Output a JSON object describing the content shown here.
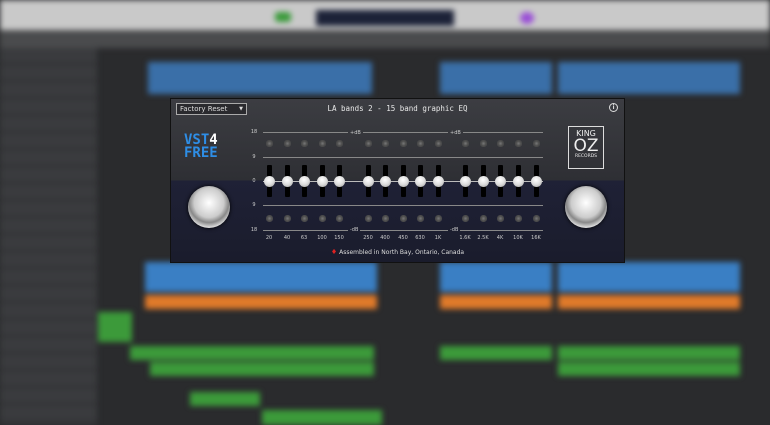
{
  "plugin": {
    "preset": "Factory Reset",
    "title": "LA bands 2 - 15 band graphic EQ",
    "info_icon": "info-icon",
    "logo_left": {
      "line1": "VST",
      "digit": "4",
      "line2": "FREE"
    },
    "logo_right": {
      "top": "KING",
      "middle": "OZ",
      "bottom": "RECORDS"
    },
    "scale": [
      "18",
      "9",
      "0",
      "9",
      "18"
    ],
    "db_label": "-dB",
    "db_label_top": "+dB",
    "bands": [
      "20",
      "40",
      "63",
      "100",
      "150",
      "250",
      "400",
      "450",
      "630",
      "1K",
      "1.6K",
      "2.5K",
      "4K",
      "10K",
      "16K"
    ],
    "band_gains_db": [
      0,
      0,
      0,
      0,
      0,
      0,
      0,
      0,
      0,
      0,
      0,
      0,
      0,
      0,
      0
    ],
    "footer": "Assembled in North Bay, Ontario, Canada"
  },
  "colors": {
    "accent_blue": "#2e8ee6",
    "region_blue": "#3a7fc4",
    "region_orange": "#e07a2a",
    "region_green": "#3c9a3a"
  }
}
